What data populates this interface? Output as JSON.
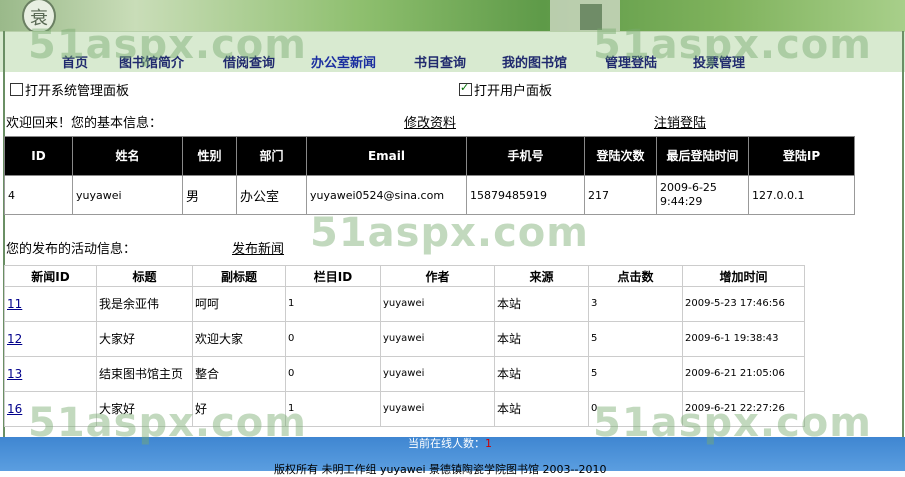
{
  "banner": {
    "logo_glyph": "衰"
  },
  "nav": [
    {
      "label": "首页"
    },
    {
      "label": "图书馆简介"
    },
    {
      "label": "借阅查询"
    },
    {
      "label": "办公室新闻"
    },
    {
      "label": "书目查询"
    },
    {
      "label": "我的图书馆"
    },
    {
      "label": "管理登陆"
    },
    {
      "label": "投票管理"
    }
  ],
  "panels": {
    "system": {
      "label": "打开系统管理面板",
      "checked": false
    },
    "user": {
      "label": "打开用户面板",
      "checked": true
    }
  },
  "welcome": {
    "text": "欢迎回来！您的基本信息：",
    "edit_link": "修改资料",
    "logout_link": "注销登陆"
  },
  "info_table": {
    "headers": [
      "ID",
      "姓名",
      "性别",
      "部门",
      "Email",
      "手机号",
      "登陆次数",
      "最后登陆时间",
      "登陆IP"
    ],
    "row": [
      "4",
      "yuyawei",
      "男",
      "办公室",
      "yuyawei0524@sina.com",
      "15879485919",
      "217",
      "2009-6-25 9:44:29",
      "127.0.0.1"
    ]
  },
  "activity": {
    "text": "您的发布的活动信息：",
    "publish_link": "发布新闻"
  },
  "news_table": {
    "headers": [
      "新闻ID",
      "标题",
      "副标题",
      "栏目ID",
      "作者",
      "来源",
      "点击数",
      "增加时间"
    ],
    "rows": [
      [
        "11",
        "我是余亚伟",
        "呵呵",
        "1",
        "yuyawei",
        "本站",
        "3",
        "2009-5-23 17:46:56"
      ],
      [
        "12",
        "大家好",
        "欢迎大家",
        "0",
        "yuyawei",
        "本站",
        "5",
        "2009-6-1 19:38:43"
      ],
      [
        "13",
        "结束图书馆主页",
        "整合",
        "0",
        "yuyawei",
        "本站",
        "5",
        "2009-6-21 21:05:06"
      ],
      [
        "16",
        "大家好",
        "好",
        "1",
        "yuyawei",
        "本站",
        "0",
        "2009-6-21 22:27:26"
      ]
    ]
  },
  "footer": {
    "online_label": "当前在线人数：",
    "online_count": "1",
    "copyright": "版权所有 未明工作组 yuyawei    景德镇陶瓷学院图书馆 2003--2010"
  },
  "watermark": "51aspx.com",
  "colors": {
    "nav_text": "#202a6e",
    "footer_bg": "#4a8fd8",
    "header_bg": "#000000"
  }
}
